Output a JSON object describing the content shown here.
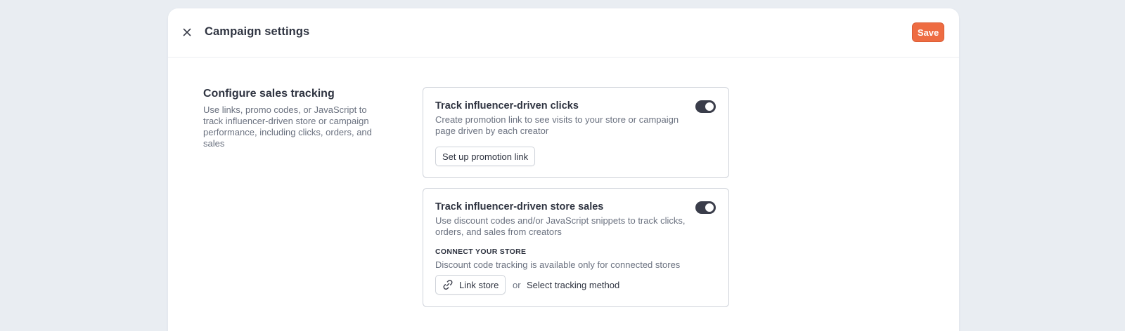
{
  "header": {
    "title": "Campaign settings",
    "save_label": "Save",
    "close_icon": "close-icon"
  },
  "section": {
    "title": "Configure sales tracking",
    "description": "Use links, promo codes, or JavaScript to track influencer-driven store or campaign performance, including clicks, orders, and sales"
  },
  "cards": [
    {
      "title": "Track influencer-driven clicks",
      "description": "Create promotion link to see visits to your store or campaign page driven by each creator",
      "toggle_on": true,
      "button_label": "Set up promotion link"
    },
    {
      "title": "Track influencer-driven store sales",
      "description": "Use discount codes and/or JavaScript snippets to track clicks, orders, and sales from creators",
      "toggle_on": true,
      "subheading": "CONNECT YOUR STORE",
      "subdescription": "Discount code tracking is available only for connected stores",
      "link_store_label": "Link store",
      "link_icon": "link-icon",
      "or_text": "or",
      "select_method_label": "Select tracking method"
    }
  ],
  "colors": {
    "accent": "#ee6c42",
    "toggle_on": "#3a3d4a",
    "background": "#e9edf2"
  }
}
